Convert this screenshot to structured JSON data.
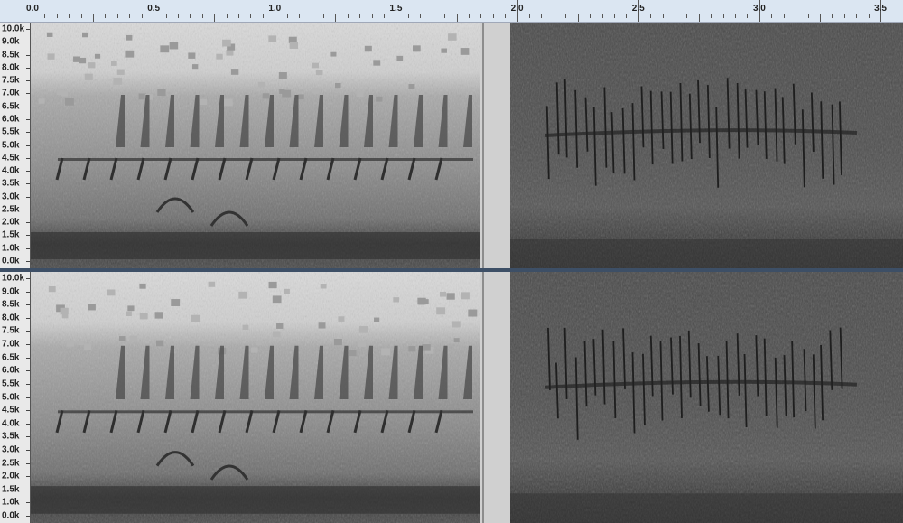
{
  "time_ruler": {
    "labels": [
      "0.0",
      "0.5",
      "1.0",
      "1.5",
      "2.0",
      "2.5",
      "3.0",
      "3.5"
    ]
  },
  "frequency_axis": {
    "labels": [
      "10.0k",
      "9.0k",
      "8.5k",
      "8.0k",
      "7.5k",
      "7.0k",
      "6.5k",
      "6.0k",
      "5.5k",
      "5.0k",
      "4.5k",
      "4.0k",
      "3.5k",
      "3.0k",
      "2.5k",
      "2.0k",
      "1.5k",
      "1.0k",
      "0.0k"
    ]
  },
  "tracks": [
    {
      "channel": "top"
    },
    {
      "channel": "bottom"
    }
  ],
  "colors": {
    "ruler_bg": "#dbe6f2",
    "spectrogram_light": "#d8d8d8",
    "spectrogram_dark": "#3a3a3a",
    "divider": "#3d4f66"
  }
}
